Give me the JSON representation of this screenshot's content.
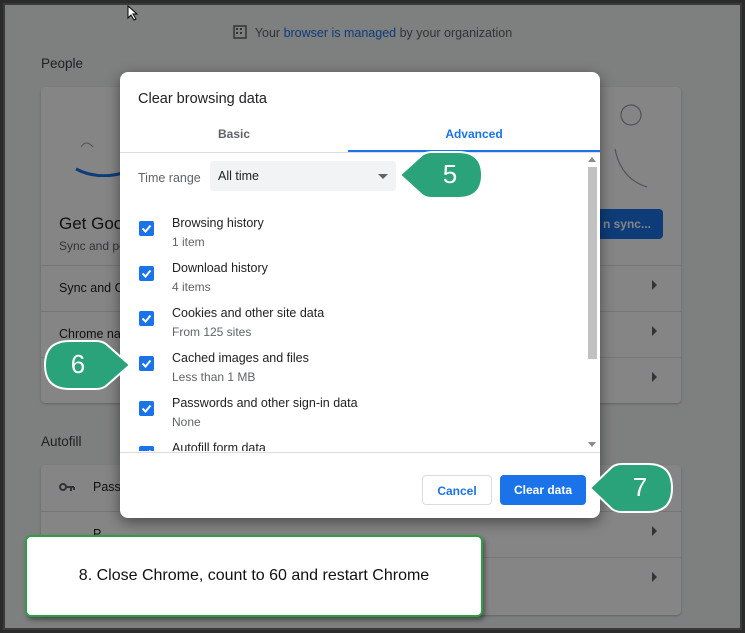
{
  "background": {
    "managed_notice": {
      "prefix": "Your ",
      "link": "browser is managed",
      "suffix": " by your organization"
    },
    "people_title": "People",
    "sync_card_title": "Get Goo",
    "sync_card_sub": "Sync and pe",
    "sync_button": "n sync...",
    "rows": [
      "Sync and G",
      "Chrome na",
      "oo"
    ],
    "autofill_title": "Autofill",
    "autofill_rows": [
      "Pass",
      "P"
    ]
  },
  "dialog": {
    "title": "Clear browsing data",
    "tabs": [
      {
        "label": "Basic"
      },
      {
        "label": "Advanced"
      }
    ],
    "time_range": {
      "label": "Time range",
      "value": "All time"
    },
    "items": [
      {
        "title": "Browsing history",
        "sub": "1 item"
      },
      {
        "title": "Download history",
        "sub": "4 items"
      },
      {
        "title": "Cookies and other site data",
        "sub": "From 125 sites"
      },
      {
        "title": "Cached images and files",
        "sub": "Less than 1 MB"
      },
      {
        "title": "Passwords and other sign-in data",
        "sub": "None"
      },
      {
        "title": "Autofill form data",
        "sub": ""
      }
    ],
    "cancel_label": "Cancel",
    "clear_label": "Clear data"
  },
  "callouts": {
    "five": "5",
    "six": "6",
    "seven": "7"
  },
  "note": "8. Close Chrome, count to 60 and restart Chrome",
  "colors": {
    "accent": "#1a73e8",
    "callout": "#2aa37b",
    "note_border": "#2e9e44"
  }
}
